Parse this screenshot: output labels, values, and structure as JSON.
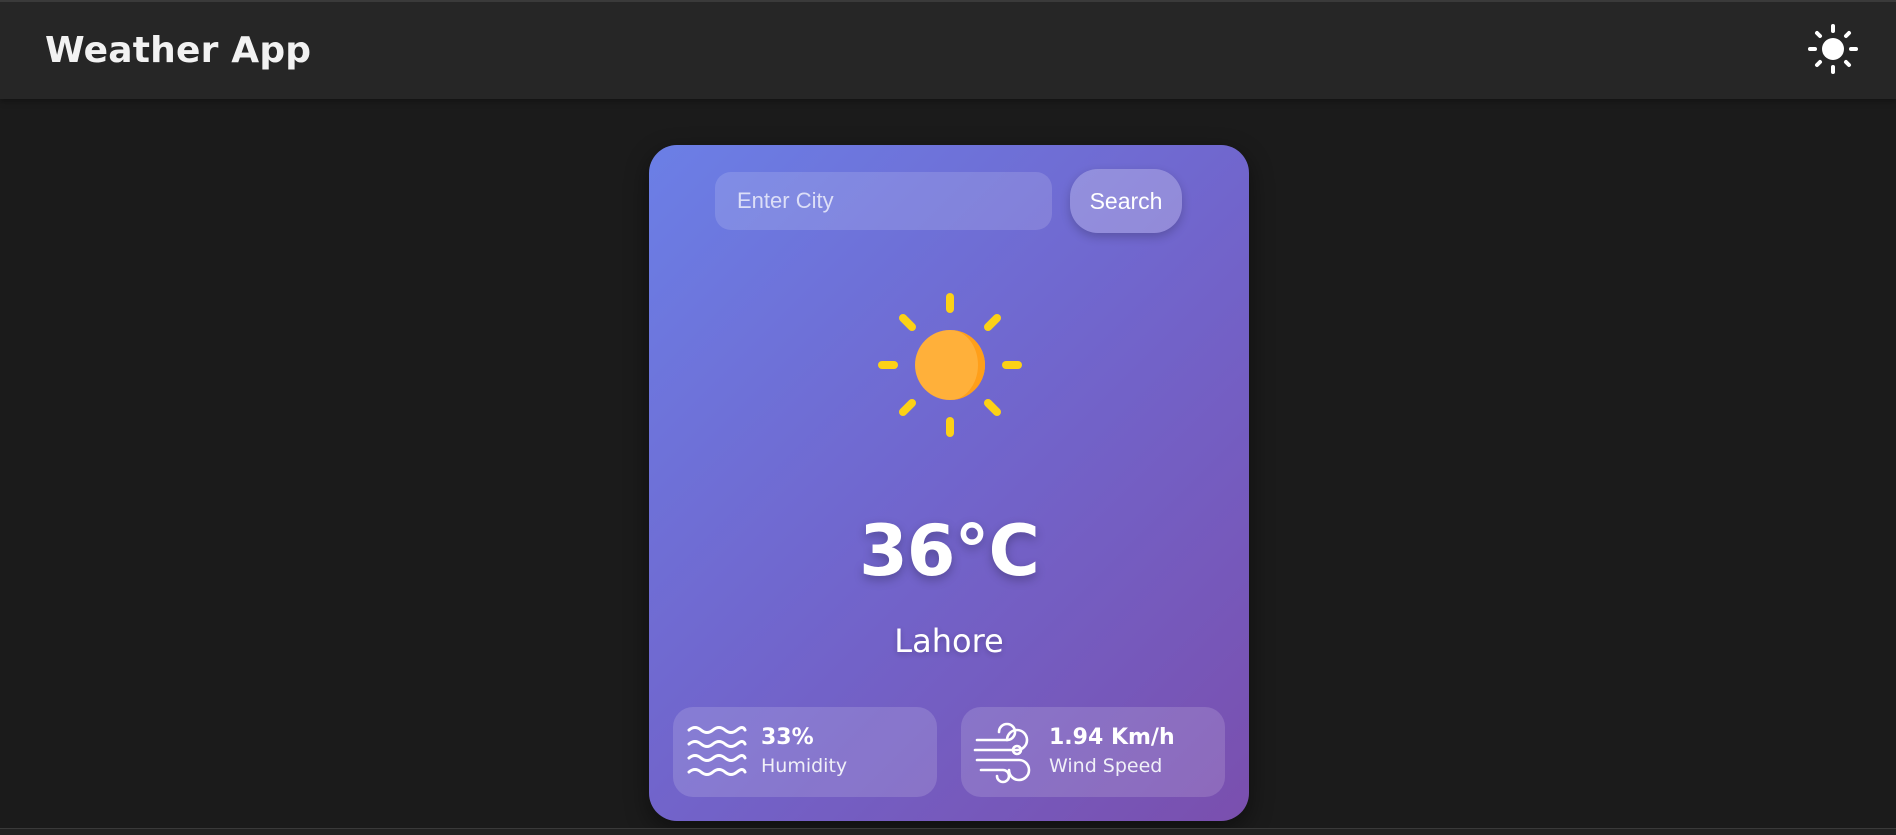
{
  "header": {
    "title": "Weather App",
    "theme_icon": "sun-icon"
  },
  "search": {
    "placeholder": "Enter City",
    "value": "",
    "button_label": "Search"
  },
  "weather": {
    "icon": "sun-icon",
    "temperature": "36°C",
    "city": "Lahore"
  },
  "stats": {
    "humidity": {
      "value": "33%",
      "label": "Humidity",
      "icon": "waves-icon"
    },
    "wind": {
      "value": "1.94 Km/h",
      "label": "Wind Speed",
      "icon": "wind-icon"
    }
  },
  "colors": {
    "page_background": "#1b1b1b",
    "header_background": "#262626",
    "card_gradient_start": "#6b7fe6",
    "card_gradient_end": "#7a4fae",
    "sun_rays": "#fcd116",
    "sun_core": "#ffb03a"
  }
}
